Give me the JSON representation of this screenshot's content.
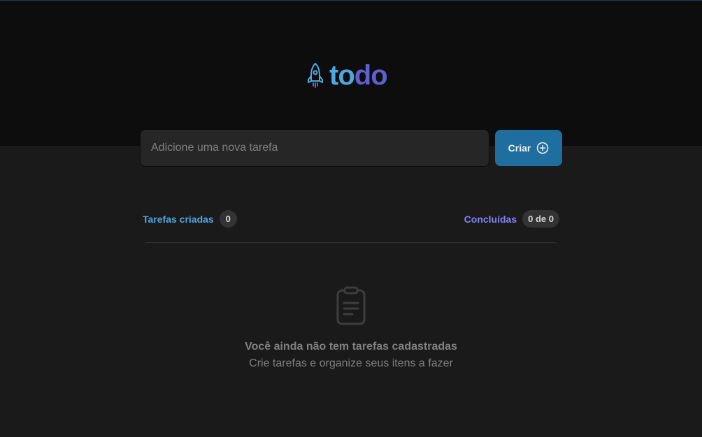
{
  "header": {
    "logo_part1": "to",
    "logo_part2": "do",
    "colors": {
      "logo_to": "#4ea8de",
      "logo_do": "#5e60ce",
      "background": "#0d0d0d"
    },
    "logo_icon": "rocket-icon"
  },
  "new_task": {
    "placeholder": "Adicione uma nova tarefa",
    "value": "",
    "create_label": "Criar",
    "create_icon": "plus-circle-icon",
    "button_color": "#1e6f9f"
  },
  "counters": {
    "created_label": "Tarefas criadas",
    "created_count": "0",
    "done_label": "Concluídas",
    "done_count": "0 de 0"
  },
  "empty_state": {
    "icon": "clipboard-icon",
    "title": "Você ainda não tem tarefas cadastradas",
    "subtitle": "Crie tarefas e organize seus itens a fazer"
  }
}
